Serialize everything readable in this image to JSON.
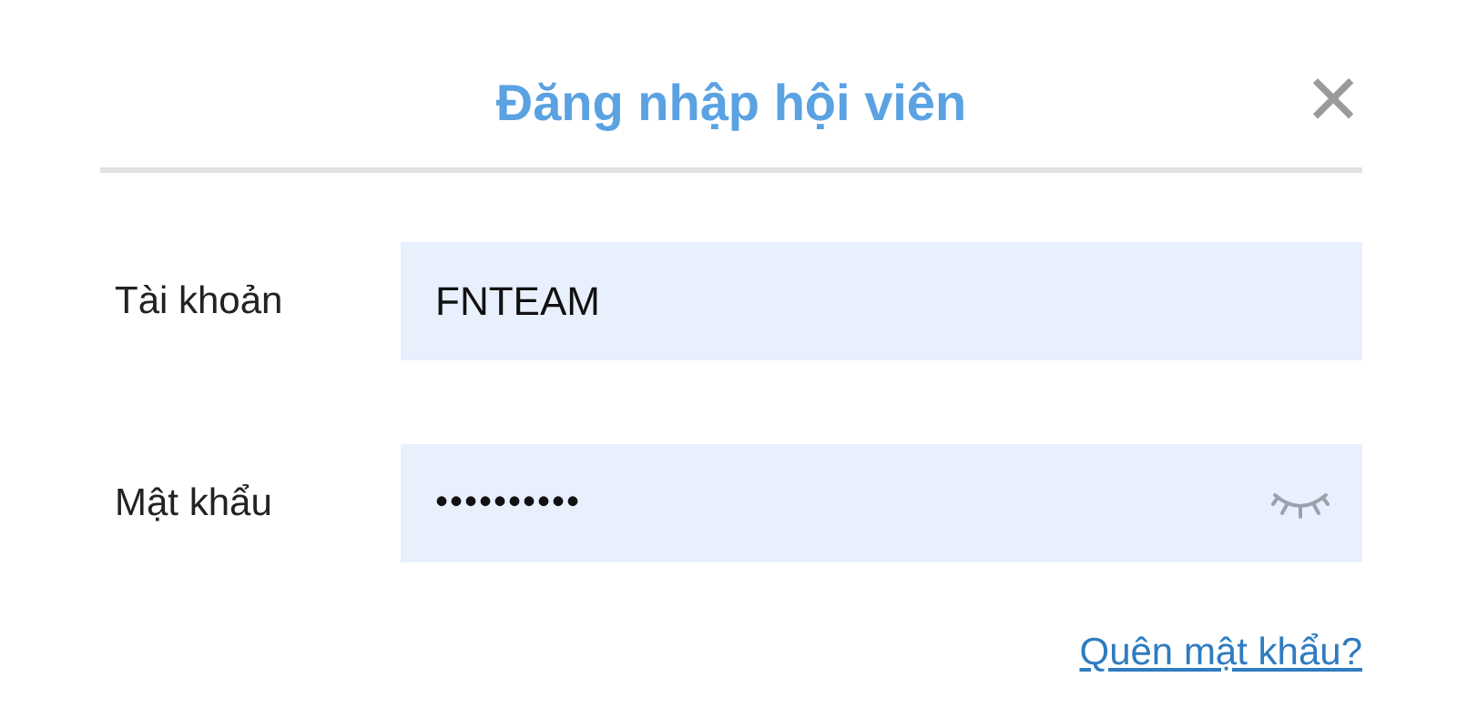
{
  "dialog": {
    "title": "Đăng nhập hội viên",
    "close": "✕"
  },
  "fields": [
    {
      "kind": "text",
      "label": "Tài khoản",
      "value": "FNTEAM"
    },
    {
      "kind": "password",
      "label": "Mật khẩu",
      "value": "••••••••••"
    }
  ],
  "forgot_link": "Quên mật khẩu?"
}
